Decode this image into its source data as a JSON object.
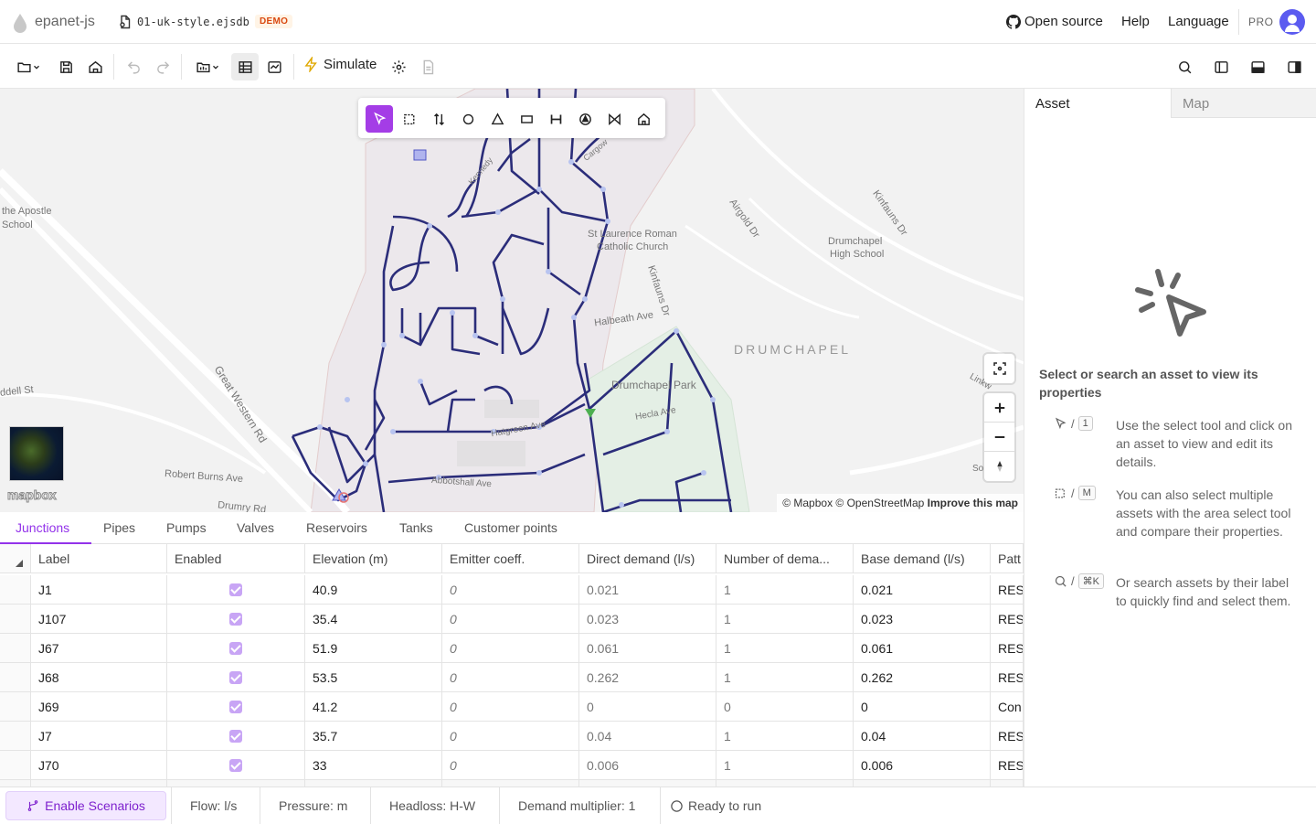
{
  "app": {
    "name": "epanet-js",
    "file_name": "01-uk-style.ejsdb",
    "badge": "DEMO"
  },
  "top_nav": {
    "open_source": "Open source",
    "help": "Help",
    "language": "Language",
    "pro": "PRO"
  },
  "toolbar": {
    "simulate_label": "Simulate"
  },
  "map": {
    "labels": {
      "apostle": "the Apostle",
      "school": "School",
      "laurence": "St Laurence Roman",
      "catholic": "Catholic Church",
      "airgold": "Airgold Dr",
      "kinfauns_top": "Kinfauns Dr",
      "kinfauns_mid": "Kinfauns Dr",
      "drumchapel_high": "Drumchapel",
      "high_school": "High School",
      "halbeath": "Halbeath Ave",
      "drumchapel": "DRUMCHAPEL",
      "park": "Drumchapel Park",
      "hecla": "Hecla Ave",
      "hatgreen": "Hatgreen Ave",
      "great_western": "Great Western Rd",
      "robert_burns": "Robert Burns Ave",
      "abbotshall": "Abbotshall Ave",
      "drumry": "Drumry Rd",
      "dell": "ddell St",
      "linkw": "Linkw",
      "so": "So",
      "kennedy": "Kennedy",
      "cargow": "Cargow"
    },
    "logo": "mapbox",
    "attribution": "© Mapbox © OpenStreetMap",
    "improve": "Improve this map"
  },
  "right_panel": {
    "tabs": [
      "Asset",
      "Map"
    ],
    "hint_title": "Select or search an asset to view its properties",
    "hints": [
      {
        "key": "1",
        "text": "Use the select tool and click on an asset to view and edit its details."
      },
      {
        "key": "M",
        "text": "You can also select multiple assets with the area select tool and compare their properties."
      },
      {
        "key": "⌘K",
        "text": "Or search assets by their label to quickly find and select them."
      }
    ]
  },
  "table_tabs": [
    "Junctions",
    "Pipes",
    "Pumps",
    "Valves",
    "Reservoirs",
    "Tanks",
    "Customer points"
  ],
  "table": {
    "columns": [
      "Label",
      "Enabled",
      "Elevation (m)",
      "Emitter coeff.",
      "Direct demand (l/s)",
      "Number of dema...",
      "Base demand (l/s)",
      "Patt"
    ],
    "rows": [
      {
        "label": "J1",
        "elevation": "40.9",
        "emitter": "0",
        "direct": "0.021",
        "number": "1",
        "base": "0.021",
        "pattern": "RES"
      },
      {
        "label": "J107",
        "elevation": "35.4",
        "emitter": "0",
        "direct": "0.023",
        "number": "1",
        "base": "0.023",
        "pattern": "RES"
      },
      {
        "label": "J67",
        "elevation": "51.9",
        "emitter": "0",
        "direct": "0.061",
        "number": "1",
        "base": "0.061",
        "pattern": "RES"
      },
      {
        "label": "J68",
        "elevation": "53.5",
        "emitter": "0",
        "direct": "0.262",
        "number": "1",
        "base": "0.262",
        "pattern": "RES"
      },
      {
        "label": "J69",
        "elevation": "41.2",
        "emitter": "0",
        "direct": "0",
        "number": "0",
        "base": "0",
        "pattern": "Con"
      },
      {
        "label": "J7",
        "elevation": "35.7",
        "emitter": "0",
        "direct": "0.04",
        "number": "1",
        "base": "0.04",
        "pattern": "RES"
      },
      {
        "label": "J70",
        "elevation": "33",
        "emitter": "0",
        "direct": "0.006",
        "number": "1",
        "base": "0.006",
        "pattern": "RES"
      }
    ]
  },
  "status_bar": {
    "scenarios": "Enable Scenarios",
    "flow": "Flow: l/s",
    "pressure": "Pressure: m",
    "headloss": "Headloss: H-W",
    "demand": "Demand multiplier: 1",
    "ready": "Ready to run"
  },
  "colors": {
    "accent": "#9333ea",
    "network": "#2b2d7a",
    "demo_badge": "#d9480f"
  }
}
